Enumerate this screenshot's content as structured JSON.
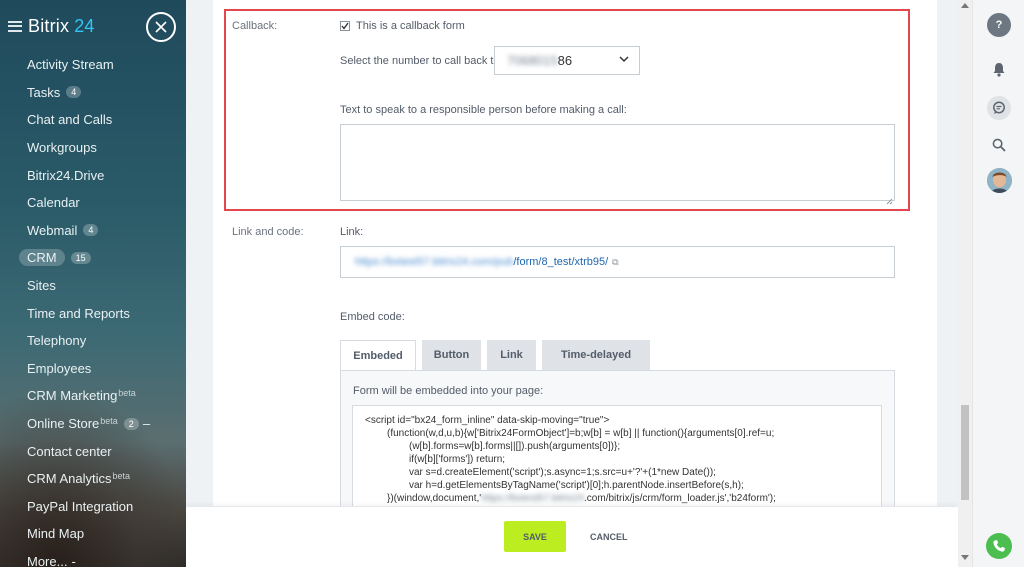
{
  "sidebar": {
    "brand": "Bitrix",
    "brand_suffix": "24",
    "items": [
      {
        "label": "Activity Stream"
      },
      {
        "label": "Tasks",
        "badge": "4"
      },
      {
        "label": "Chat and Calls"
      },
      {
        "label": "Workgroups"
      },
      {
        "label": "Bitrix24.Drive"
      },
      {
        "label": "Calendar"
      },
      {
        "label": "Webmail",
        "badge": "4"
      },
      {
        "label": "CRM",
        "badge": "15",
        "active": true
      },
      {
        "label": "Sites"
      },
      {
        "label": "Time and Reports"
      },
      {
        "label": "Telephony"
      },
      {
        "label": "Employees"
      },
      {
        "label": "CRM Marketing",
        "sup": "beta"
      },
      {
        "label": "Online Store",
        "sup": "beta",
        "badge": "2",
        "dash": "–"
      },
      {
        "label": "Contact center"
      },
      {
        "label": "CRM Analytics",
        "sup": "beta"
      },
      {
        "label": "PayPal Integration"
      },
      {
        "label": "Mind Map"
      },
      {
        "label": "More...",
        "dash": "-"
      }
    ]
  },
  "form": {
    "callback_label": "Callback:",
    "callback_checkbox_label": "This is a callback form",
    "callback_checked": true,
    "select_number_label": "Select the number to call back to:",
    "number_blurred": "7068015",
    "number_visible": "86",
    "speak_text_label": "Text to speak to a responsible person before making a call:",
    "speak_text_value": "",
    "link_and_code_label": "Link and code:",
    "link_label": "Link:",
    "link_blurred": "https://bxtest57.bitrix24.com/pub",
    "link_visible": "/form/8_test/xtrb95/",
    "embed_code_label": "Embed code:",
    "tabs": [
      "Embeded",
      "Button",
      "Link",
      "Time-delayed"
    ],
    "active_tab": "Embeded",
    "panel_note": "Form will be embedded into your page:",
    "code_lines": [
      "<script id=\"bx24_form_inline\" data-skip-moving=\"true\">",
      "(function(w,d,u,b){w['Bitrix24FormObject']=b;w[b] = w[b] || function(){arguments[0].ref=u;",
      "(w[b].forms=w[b].forms||[]).push(arguments[0])};",
      "if(w[b]['forms']) return;",
      "var s=d.createElement('script');s.async=1;s.src=u+'?'+(1*new Date());",
      "var h=d.getElementsByTagName('script')[0];h.parentNode.insertBefore(s,h);",
      "})(window,document,'",
      "https://bxtest57.bitrix24",
      ".com/bitrix/js/crm/form_loader.js','b24form');"
    ]
  },
  "footer": {
    "save_label": "SAVE",
    "cancel_label": "CANCEL"
  },
  "rightbar": {
    "help_label": "?"
  },
  "colors": {
    "accent_green": "#bbed21",
    "highlight_red": "#e3474d",
    "link_blue": "#2067b0",
    "brand_blue": "#2fc6f6"
  }
}
